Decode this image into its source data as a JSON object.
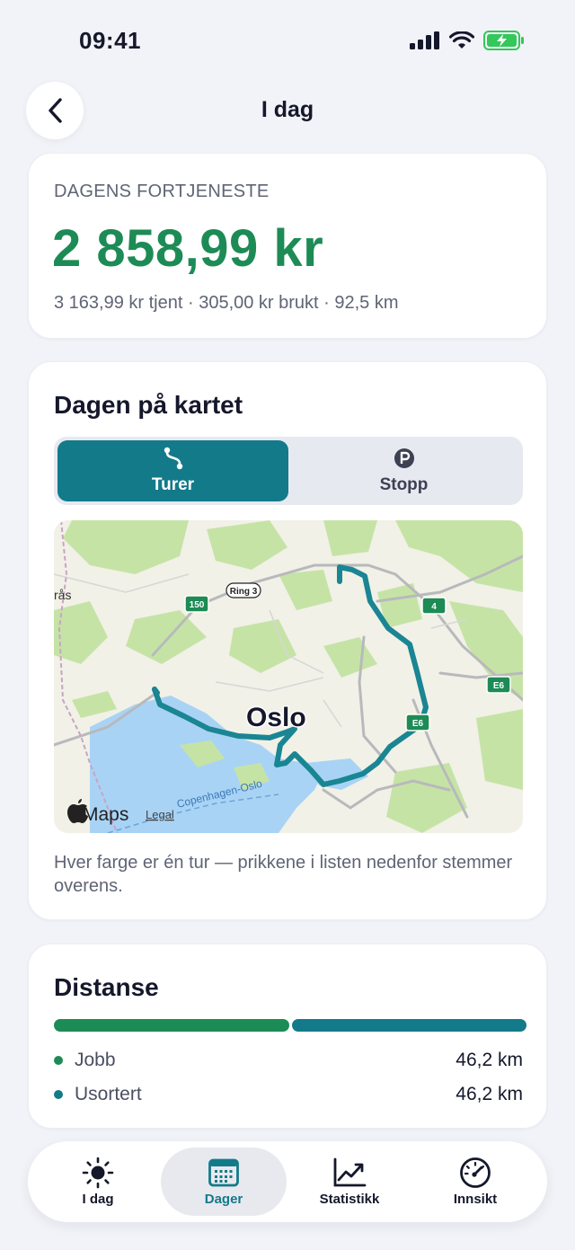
{
  "status_bar": {
    "time": "09:41"
  },
  "header": {
    "title": "I dag"
  },
  "earnings": {
    "label": "DAGENS FORTJENESTE",
    "amount": "2 858,99 kr",
    "summary": "3 163,99 kr tjent · 305,00 kr brukt · 92,5 km"
  },
  "map_section": {
    "title": "Dagen på kartet",
    "segments": [
      {
        "label": "Turer",
        "icon": "route-icon",
        "selected": true
      },
      {
        "label": "Stopp",
        "icon": "parking-icon",
        "selected": false
      }
    ],
    "map": {
      "city_label": "Oslo",
      "edge_label": "rås",
      "road_badges": [
        "150",
        "Ring 3",
        "4",
        "E6",
        "E6"
      ],
      "ferry_label": "Copenhagen-Oslo",
      "attribution": "Maps",
      "legal": "Legal",
      "route_color": "#1a8593"
    },
    "caption": "Hver farge er én tur — prikkene i listen nedenfor stemmer overens."
  },
  "distance": {
    "title": "Distanse",
    "rows": [
      {
        "label": "Jobb",
        "value": "46,2 km",
        "color": "#1d8b55",
        "fraction": 0.5
      },
      {
        "label": "Usortert",
        "value": "46,2 km",
        "color": "#137a8a",
        "fraction": 0.5
      }
    ]
  },
  "tab_bar": {
    "tabs": [
      {
        "label": "I dag",
        "icon": "sun-icon",
        "active": false
      },
      {
        "label": "Dager",
        "icon": "calendar-icon",
        "active": true
      },
      {
        "label": "Statistikk",
        "icon": "chart-icon",
        "active": false
      },
      {
        "label": "Innsikt",
        "icon": "gauge-icon",
        "active": false
      }
    ]
  },
  "colors": {
    "accent": "#137a8a",
    "earnings_green": "#1d8b55",
    "background": "#f2f3f8"
  }
}
